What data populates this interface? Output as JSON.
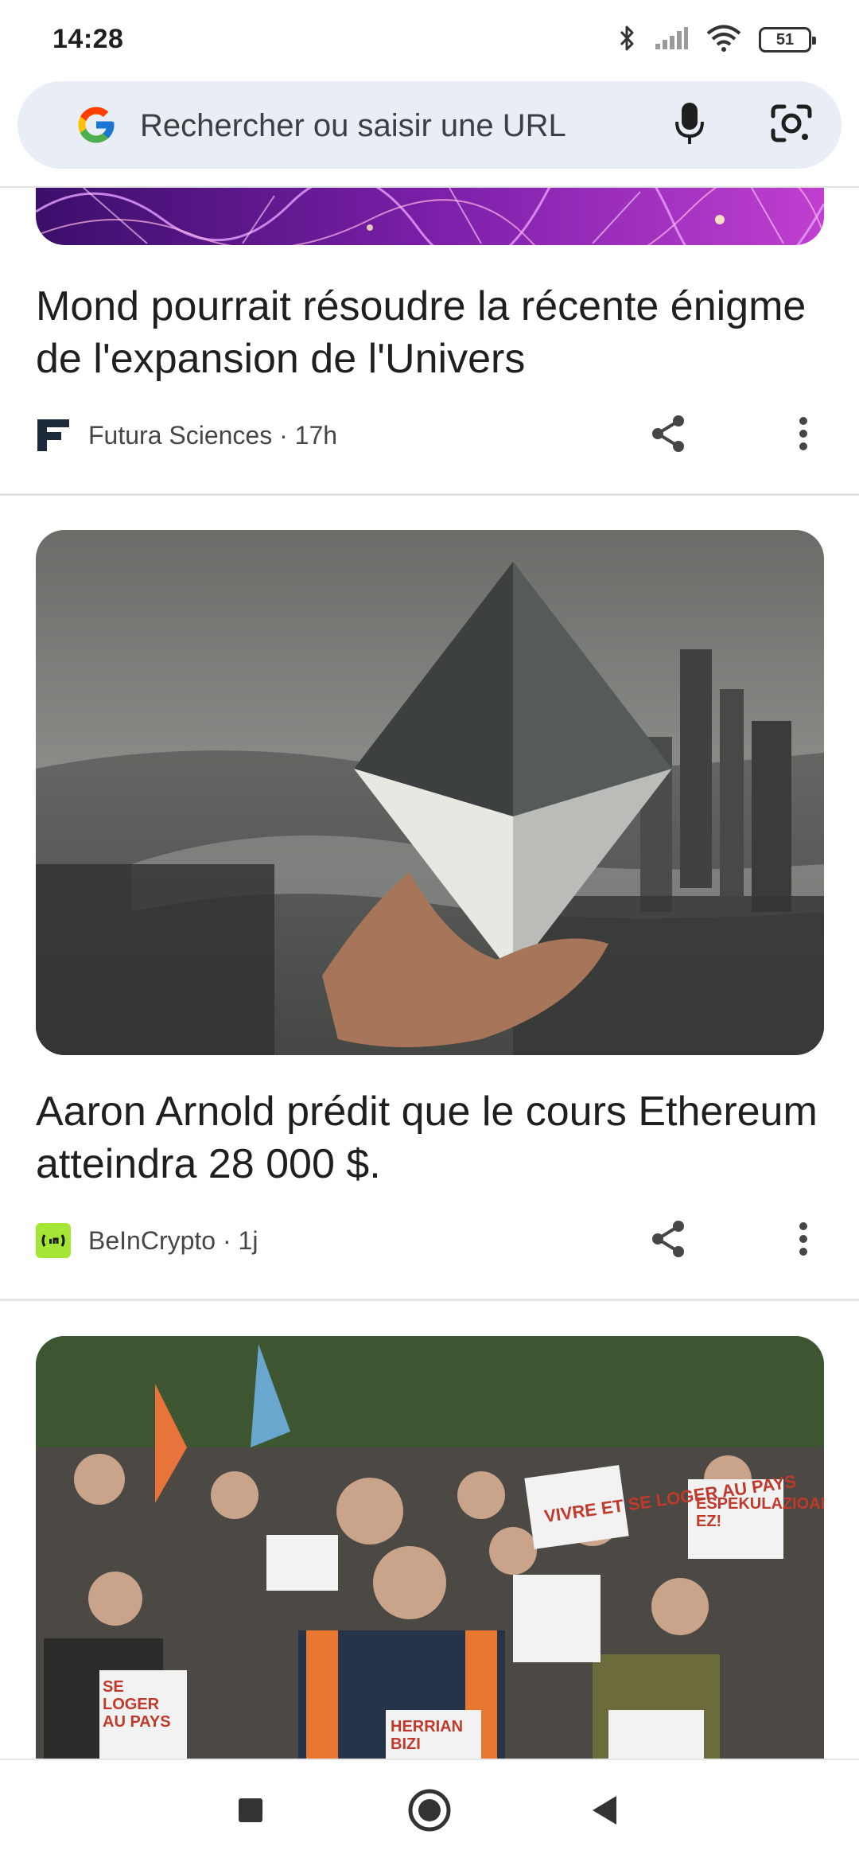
{
  "status_bar": {
    "time": "14:28",
    "battery": "51",
    "icons": [
      "bluetooth-icon",
      "signal-icon",
      "wifi-icon",
      "battery-icon"
    ]
  },
  "search": {
    "placeholder": "Rechercher ou saisir une URL",
    "icons": [
      "google-logo-icon",
      "microphone-icon",
      "google-lens-icon"
    ]
  },
  "feed": {
    "cards": [
      {
        "image_desc_icon": "cosmic-web-image",
        "headline": "Mond pourrait résoudre la récente énigme de l'expansion de l'Univers",
        "source": "Futura Sciences · 17h",
        "source_logo": "futura-logo"
      },
      {
        "image_desc_icon": "ethereum-crystal-image",
        "headline": "Aaron Arnold prédit que le cours Ethereum atteindra 28 000 $.",
        "source": "BeInCrypto · 1j",
        "source_logo": "beincrypto-logo"
      },
      {
        "image_desc_icon": "protest-crowd-image",
        "signs": [
          "VIVRE ET SE LOGER AU PAYS",
          "ESPEKULAZIOARI EZ!",
          "SE LOGER AU PAYS",
          "HERRIAN BIZI"
        ]
      }
    ]
  },
  "nav": {
    "buttons": [
      "recents-button",
      "home-button",
      "back-button"
    ]
  },
  "colors": {
    "search_bg": "#e9eef6",
    "beincrypto_green": "#a3e635",
    "futura_navy": "#1b2a3a"
  }
}
